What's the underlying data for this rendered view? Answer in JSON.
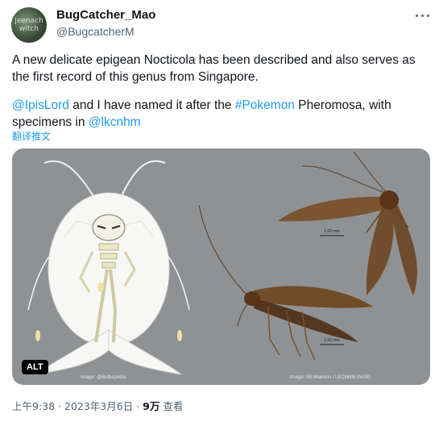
{
  "author": {
    "display_name": "BugCatcher_Mao",
    "handle": "@BugcatcherM",
    "avatar_text": "Jeenach witch"
  },
  "tweet": {
    "paragraph1": "A new delicate epigean Nocticola has been described and also serves as the first record of this genus from Singapore.",
    "mention1": "@IpisLord",
    "text_a": " and I have named it after the ",
    "hashtag": "#Pokemon",
    "text_b": " Pheromosa, with specimens in ",
    "mention2": "@lkcnhm",
    "translate_label": "翻译推文"
  },
  "media": {
    "alt_label": "ALT",
    "credit_left": "Image: @Bulbapedia",
    "credit_right": "Image: SB Maimon / LKCNHM (NUS)",
    "scale_label_top": "1.00 mm",
    "scale_label_bottom": "1.00 mm"
  },
  "meta": {
    "time": "上午9:38",
    "separator": " · ",
    "date": "2023年3月6日",
    "views_count": "9万",
    "views_label": " 查看"
  },
  "colors": {
    "link": "#1d9bf0",
    "secondary": "#536471",
    "media_bg": "#8f9294"
  }
}
